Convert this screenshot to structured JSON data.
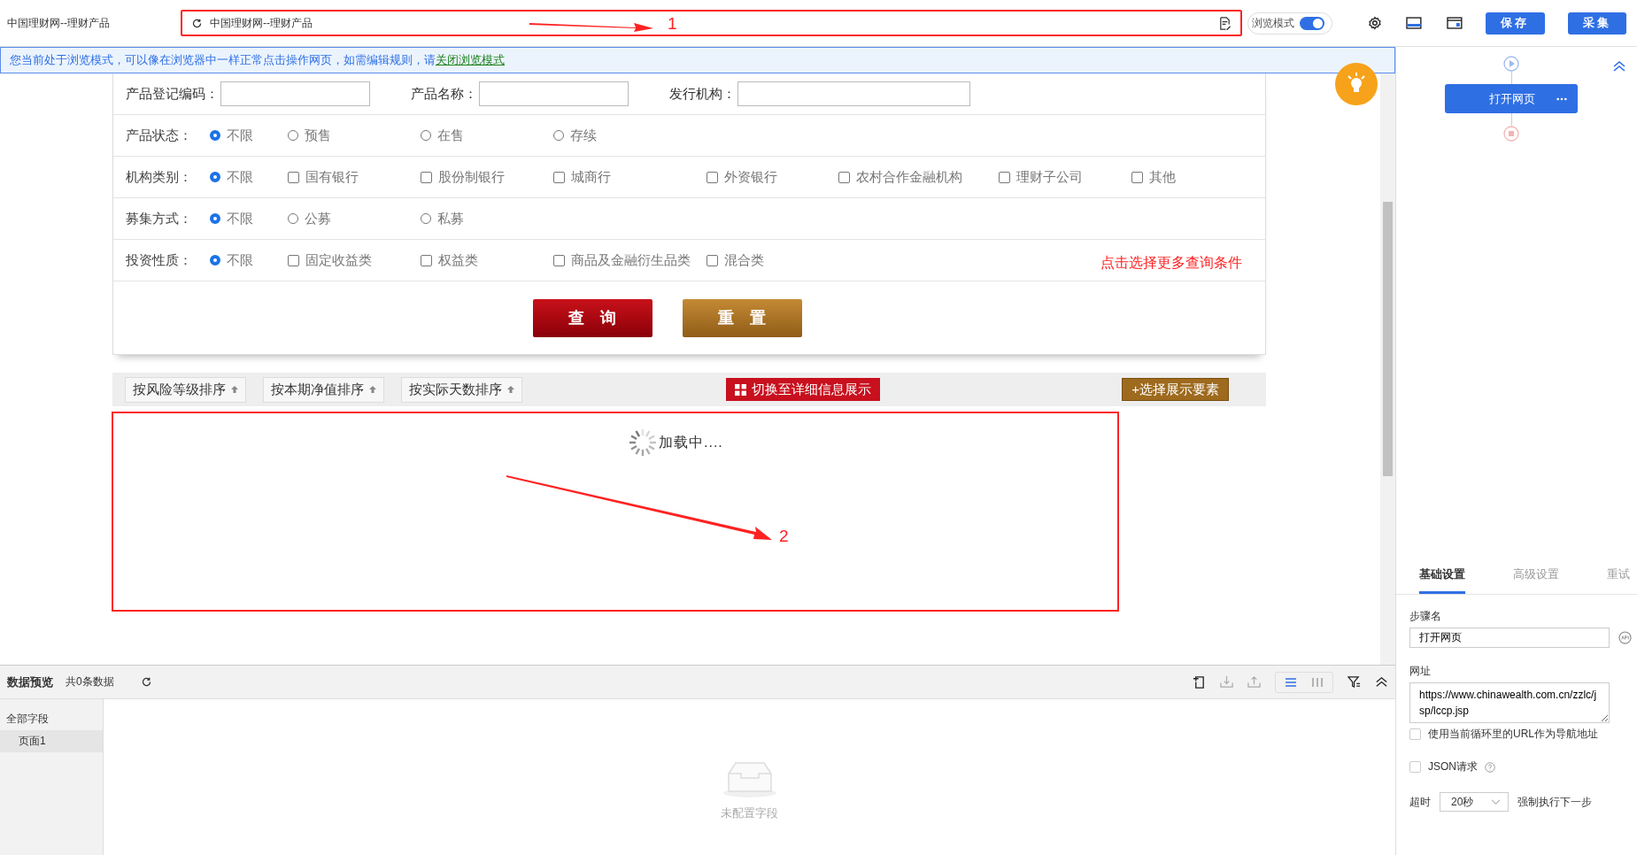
{
  "app_title": "中国理财网--理财产品",
  "address_bar": {
    "value": "中国理财网--理财产品"
  },
  "browse_mode": {
    "label": "浏览模式",
    "on": true
  },
  "top_buttons": [
    "保存",
    "采集"
  ],
  "banner": {
    "text": "您当前处于浏览模式，可以像在浏览器中一样正常点击操作网页，如需编辑规则，请",
    "link": "关闭浏览模式"
  },
  "form": {
    "text_fields": [
      {
        "label": "产品登记编码："
      },
      {
        "label": "产品名称："
      },
      {
        "label": "发行机构："
      }
    ],
    "filter_rows": [
      {
        "label": "产品状态：",
        "options": [
          {
            "kind": "radio",
            "label": "不限",
            "selected": true
          },
          {
            "kind": "radio",
            "label": "预售",
            "selected": false
          },
          {
            "kind": "radio",
            "label": "在售",
            "selected": false
          },
          {
            "kind": "radio",
            "label": "存续",
            "selected": false
          }
        ]
      },
      {
        "label": "机构类别：",
        "options": [
          {
            "kind": "radio",
            "label": "不限",
            "selected": true
          },
          {
            "kind": "checkbox",
            "label": "国有银行",
            "checked": false
          },
          {
            "kind": "checkbox",
            "label": "股份制银行",
            "checked": false
          },
          {
            "kind": "checkbox",
            "label": "城商行",
            "checked": false
          },
          {
            "kind": "checkbox",
            "label": "外资银行",
            "checked": false
          },
          {
            "kind": "checkbox",
            "label": "农村合作金融机构",
            "checked": false
          },
          {
            "kind": "checkbox",
            "label": "理财子公司",
            "checked": false
          },
          {
            "kind": "checkbox",
            "label": "其他",
            "checked": false
          }
        ]
      },
      {
        "label": "募集方式：",
        "options": [
          {
            "kind": "radio",
            "label": "不限",
            "selected": true
          },
          {
            "kind": "radio",
            "label": "公募",
            "selected": false
          },
          {
            "kind": "radio",
            "label": "私募",
            "selected": false
          }
        ]
      },
      {
        "label": "投资性质：",
        "options": [
          {
            "kind": "radio",
            "label": "不限",
            "selected": true
          },
          {
            "kind": "checkbox",
            "label": "固定收益类",
            "checked": false
          },
          {
            "kind": "checkbox",
            "label": "权益类",
            "checked": false
          },
          {
            "kind": "checkbox",
            "label": "商品及金融衍生品类",
            "checked": false
          },
          {
            "kind": "checkbox",
            "label": "混合类",
            "checked": false
          }
        ],
        "more_link": "点击选择更多查询条件"
      }
    ],
    "query_button": "查　询",
    "reset_button": "重　置"
  },
  "sort_bar": {
    "sort_buttons": [
      "按风险等级排序",
      "按本期净值排序",
      "按实际天数排序"
    ],
    "switch_button": "切换至详细信息展示",
    "select_button": "+选择展示要素"
  },
  "loading_text": "加载中....",
  "annotations": [
    {
      "label": "1"
    },
    {
      "label": "2"
    }
  ],
  "flow": {
    "node": "打开网页"
  },
  "settings": {
    "tabs": [
      {
        "label": "基础设置",
        "selected": true
      },
      {
        "label": "高级设置",
        "selected": false
      },
      {
        "label": "重试",
        "selected": false
      }
    ],
    "step_name_label": "步骤名",
    "step_name": "打开网页",
    "url_label": "网址",
    "url": "https://www.chinawealth.com.cn/zzlc/jsp/lccp.jsp",
    "options": [
      {
        "label": "使用当前循环里的URL作为导航地址",
        "checked": false
      },
      {
        "label": "JSON请求",
        "checked": false
      }
    ],
    "timeout_label": "超时",
    "timeout": "20秒",
    "force_next": "强制执行下一步"
  },
  "data_preview": {
    "title": "数据预览",
    "count": "共0条数据",
    "fields": [
      {
        "label": "全部字段",
        "selected": false
      },
      {
        "label": "页面1",
        "selected": true
      }
    ],
    "view_modes": [
      {
        "kind": "rows",
        "selected": true
      },
      {
        "kind": "columns",
        "selected": false
      }
    ],
    "empty_text": "未配置字段"
  }
}
